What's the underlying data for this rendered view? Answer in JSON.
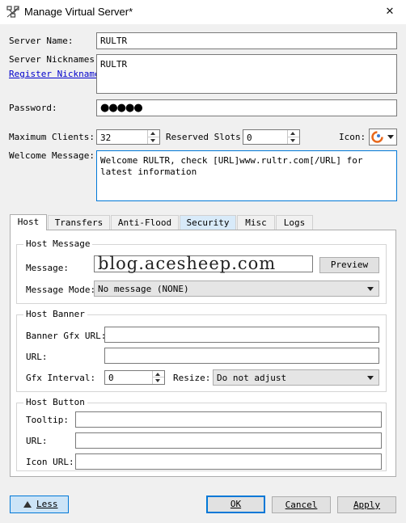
{
  "window": {
    "title": "Manage Virtual Server*",
    "close_glyph": "✕",
    "app_icon": "network-icon"
  },
  "form": {
    "server_name_label": "Server Name:",
    "server_name_value": "RULTR",
    "nicknames_label": "Server Nicknames:",
    "nicknames_value": "RULTR",
    "register_link": "Register Nickname",
    "password_label": "Password:",
    "password_mask": "●●●●●",
    "max_clients_label": "Maximum Clients:",
    "max_clients_value": "32",
    "reserved_slots_label": "Reserved Slots:",
    "reserved_slots_value": "0",
    "icon_label": "Icon:",
    "welcome_label": "Welcome Message:",
    "welcome_value": "Welcome RULTR, check [URL]www.rultr.com[/URL] for latest information"
  },
  "tabs": [
    {
      "label": "Host"
    },
    {
      "label": "Transfers"
    },
    {
      "label": "Anti-Flood"
    },
    {
      "label": "Security"
    },
    {
      "label": "Misc"
    },
    {
      "label": "Logs"
    }
  ],
  "host_message": {
    "title": "Host Message",
    "message_label": "Message:",
    "message_value": "blog.acesheep.com",
    "preview_button": "Preview",
    "mode_label": "Message Mode:",
    "mode_value": "No message (NONE)"
  },
  "host_banner": {
    "title": "Host Banner",
    "gfx_url_label": "Banner Gfx URL:",
    "gfx_url_value": "",
    "url_label": "URL:",
    "url_value": "",
    "interval_label": "Gfx Interval:",
    "interval_value": "0",
    "resize_label": "Resize:",
    "resize_value": "Do not adjust"
  },
  "host_button": {
    "title": "Host Button",
    "tooltip_label": "Tooltip:",
    "tooltip_value": "",
    "url_label": "URL:",
    "url_value": "",
    "icon_url_label": "Icon URL:",
    "icon_url_value": ""
  },
  "footer": {
    "less_button": "Less",
    "ok_button": "OK",
    "cancel_button": "Cancel",
    "apply_button": "Apply"
  },
  "colors": {
    "link": "#0000cc",
    "accent": "#0078d7",
    "icon_orange": "#e8681c"
  }
}
